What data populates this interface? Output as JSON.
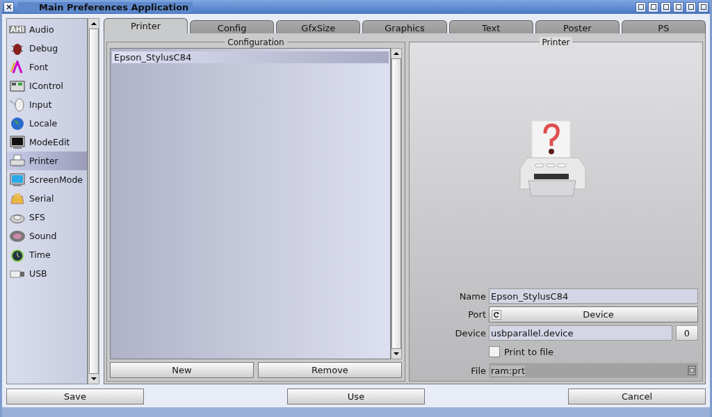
{
  "window": {
    "title": "Main Preferences Application"
  },
  "sidebar": {
    "items": [
      {
        "label": "Audio",
        "icon_label": "AHI",
        "selected": false
      },
      {
        "label": "Debug",
        "selected": false
      },
      {
        "label": "Font",
        "selected": false
      },
      {
        "label": "IControl",
        "selected": false
      },
      {
        "label": "Input",
        "selected": false
      },
      {
        "label": "Locale",
        "selected": false
      },
      {
        "label": "ModeEdit",
        "selected": false
      },
      {
        "label": "Printer",
        "selected": true
      },
      {
        "label": "ScreenMode",
        "selected": false
      },
      {
        "label": "Serial",
        "selected": false
      },
      {
        "label": "SFS",
        "selected": false
      },
      {
        "label": "Sound",
        "selected": false
      },
      {
        "label": "Time",
        "selected": false
      },
      {
        "label": "USB",
        "selected": false
      }
    ]
  },
  "tabs": [
    {
      "label": "Printer",
      "selected": true
    },
    {
      "label": "Config",
      "selected": false
    },
    {
      "label": "GfxSize",
      "selected": false
    },
    {
      "label": "Graphics",
      "selected": false
    },
    {
      "label": "Text",
      "selected": false
    },
    {
      "label": "Poster",
      "selected": false
    },
    {
      "label": "PS",
      "selected": false
    }
  ],
  "configuration": {
    "title": "Configuration",
    "items": [
      {
        "label": "Epson_StylusC84",
        "selected": true
      }
    ],
    "buttons": [
      "New",
      "Remove"
    ]
  },
  "printer": {
    "title": "Printer",
    "name": {
      "label": "Name",
      "value": "Epson_StylusC84"
    },
    "port": {
      "label": "Port",
      "value": "Device"
    },
    "device": {
      "label": "Device",
      "value": "usbparallel.device",
      "unit": "0"
    },
    "print_to_file": {
      "label": "Print to file",
      "checked": false
    },
    "file": {
      "label": "File",
      "value": "ram:prt",
      "disabled": true
    }
  },
  "buttons": [
    "Save",
    "Use",
    "Cancel"
  ]
}
